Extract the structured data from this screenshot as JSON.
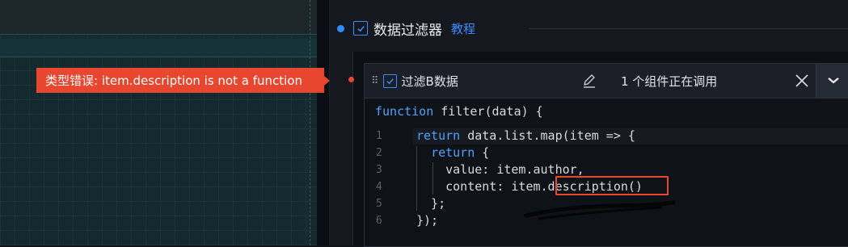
{
  "section": {
    "title": "数据过滤器",
    "tutorial_link": "教程",
    "enabled": true
  },
  "filter": {
    "name": "过滤B数据",
    "usage_text": "1 个组件正在调用",
    "enabled": true,
    "signature": "function filter(data) {",
    "lines": [
      {
        "num": "1",
        "text": "return data.list.map(item => {"
      },
      {
        "num": "2",
        "text": "  return {"
      },
      {
        "num": "3",
        "text": "    value: item.author,"
      },
      {
        "num": "4",
        "text": "    content: item.description()"
      },
      {
        "num": "5",
        "text": "  };"
      },
      {
        "num": "6",
        "text": "});"
      }
    ]
  },
  "error": {
    "message": "类型错误: item.description is not a function"
  },
  "icons": {
    "grip": "drag-handle-icon",
    "edit": "pencil-icon",
    "close": "close-icon",
    "expand": "chevron-down-icon",
    "check": "checkbox-checked-icon"
  },
  "colors": {
    "accent": "#3a8cff",
    "error": "#e8462f",
    "keyword": "#4ea3ff"
  }
}
